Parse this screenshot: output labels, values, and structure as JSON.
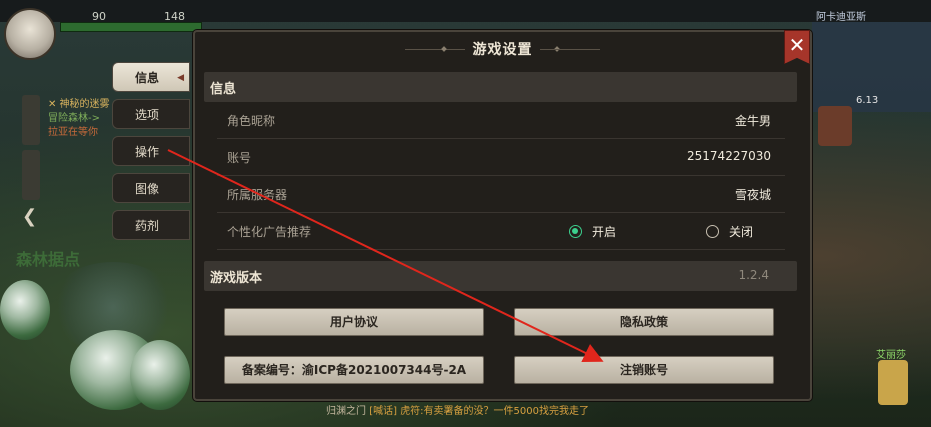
{
  "hud": {
    "hp_value": "90",
    "mp_value": "148",
    "region_name": "阿卡迪亚斯",
    "right_counter": "6.13",
    "left_quest": {
      "title": "✕ 神秘的迷雾",
      "line1": "冒险森林->",
      "line2": "拉亚在等你"
    },
    "map_label": "森林据点",
    "right_player_name": "艾丽莎",
    "chat": {
      "channel": "[喊话]",
      "prefix": "归渊之门",
      "text": "虎符:有卖署备的没？一件5000找完我走了"
    }
  },
  "dialog": {
    "title": "游戏设置",
    "close_label": "✕",
    "info_section_title": "信息",
    "rows": {
      "nickname_label": "角色昵称",
      "nickname_value": "金牛男",
      "account_label": "账号",
      "account_value": "25174227030",
      "server_label": "所属服务器",
      "server_value": "雪夜城",
      "ad_label": "个性化广告推荐",
      "ad_on_label": "开启",
      "ad_off_label": "关闭"
    },
    "ad_personalization_enabled": true,
    "version_section_title": "游戏版本",
    "version_value": "1.2.4",
    "buttons": {
      "user_agreement": "用户协议",
      "privacy_policy": "隐私政策",
      "icp_record": "备案编号：渝ICP备2021007344号-2A",
      "cancel_account": "注销账号"
    }
  },
  "tabs": [
    {
      "label": "信息",
      "active": true
    },
    {
      "label": "选项",
      "active": false
    },
    {
      "label": "操作",
      "active": false
    },
    {
      "label": "图像",
      "active": false
    },
    {
      "label": "药剂",
      "active": false
    }
  ],
  "colors": {
    "dialog_bg": "#221f1b",
    "section_bar": "#3a3631",
    "button_bg": "#cfc7b6",
    "radio_on": "#3ccf8d",
    "close_red": "#a6352a",
    "annotation_red": "#e0261c"
  }
}
